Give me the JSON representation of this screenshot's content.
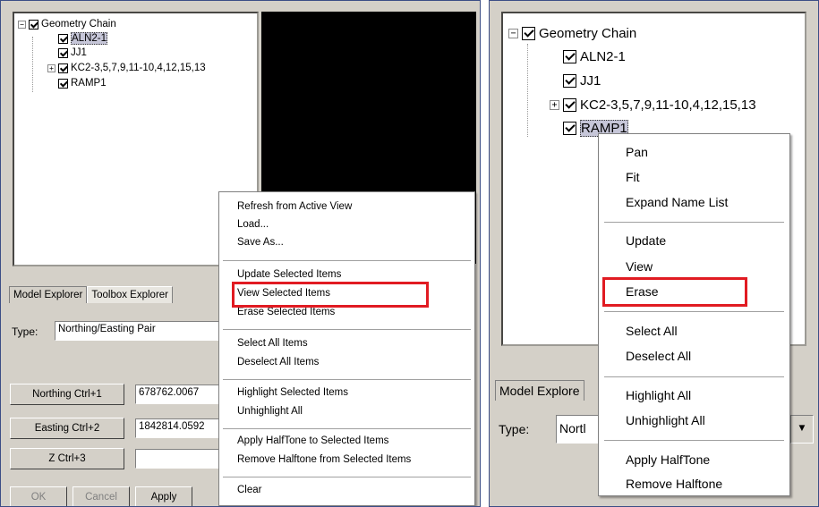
{
  "left": {
    "tree": {
      "root": "Geometry Chain",
      "items": [
        "ALN2-1",
        "JJ1",
        "KC2-3,5,7,9,11-10,4,12,15,13",
        "RAMP1"
      ]
    },
    "tabs": [
      "Model Explorer",
      "Toolbox Explorer"
    ],
    "type_label": "Type:",
    "type_value": "Northing/Easting Pair",
    "northing_button": "Northing  Ctrl+1",
    "northing_value": "678762.0067",
    "easting_button": "Easting  Ctrl+2",
    "easting_value": "1842814.0592",
    "z_button": "Z  Ctrl+3",
    "z_value": "",
    "ok_button": "OK",
    "cancel_button": "Cancel",
    "apply_button": "Apply",
    "context_menu": [
      "Refresh from Active View",
      "Load...",
      "Save As...",
      "Update Selected Items",
      "View Selected Items",
      "Erase Selected Items",
      "Select All Items",
      "Deselect All Items",
      "Highlight Selected Items",
      "Unhighlight All",
      "Apply HalfTone to Selected Items",
      "Remove Halftone from Selected Items",
      "Clear"
    ],
    "highlighted_item": "View Selected Items"
  },
  "right": {
    "tree": {
      "root": "Geometry Chain",
      "items": [
        "ALN2-1",
        "JJ1",
        "KC2-3,5,7,9,11-10,4,12,15,13",
        "RAMP1"
      ]
    },
    "tab_partial": "Model Explore",
    "type_label": "Type:",
    "type_value": "Nortl",
    "context_menu": [
      "Pan",
      "Fit",
      "Expand Name List",
      "Update",
      "View",
      "Erase",
      "Select All",
      "Deselect All",
      "Highlight All",
      "Unhighlight All",
      "Apply HalfTone",
      "Remove Halftone"
    ],
    "highlighted_item": "Erase"
  },
  "colors": {
    "highlight_border": "#e11b22",
    "window_bg": "#d4d0c8",
    "panel_border": "#3c4e86"
  }
}
